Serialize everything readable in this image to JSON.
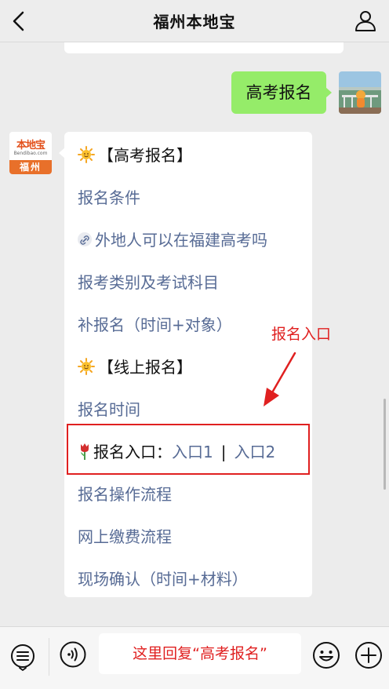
{
  "header": {
    "title": "福州本地宝"
  },
  "user_message": {
    "text": "高考报名"
  },
  "bot_avatar": {
    "logo_top": "本地宝",
    "logo_sub": "Bendibao.com",
    "logo_bottom": "福州"
  },
  "bot_card": {
    "section1_title": "【高考报名】",
    "item1": "报名条件",
    "item2": "外地人可以在福建高考吗",
    "item3": "报考类别及考试科目",
    "item4": "补报名（时间+对象）",
    "section2_title": "【线上报名】",
    "item5": "报名时间",
    "entry_label": "报名入口：",
    "entry_link1": "入口1",
    "entry_separator": "|",
    "entry_link2": "入口2",
    "item6": "报名操作流程",
    "item7": "网上缴费流程",
    "item8": "现场确认（时间+材料）"
  },
  "annotation": {
    "text": "报名入口"
  },
  "input": {
    "hint": "这里回复“高考报名”"
  },
  "colors": {
    "link": "#576b95",
    "bubble_green": "#95ec69",
    "annotation_red": "#e02020"
  }
}
